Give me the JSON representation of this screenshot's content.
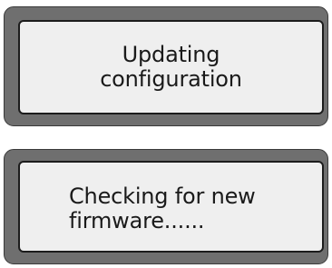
{
  "display_1": {
    "line_1": "Updating",
    "line_2": "configuration"
  },
  "display_2": {
    "line_1": "Checking for new",
    "line_2": "firmware......"
  }
}
